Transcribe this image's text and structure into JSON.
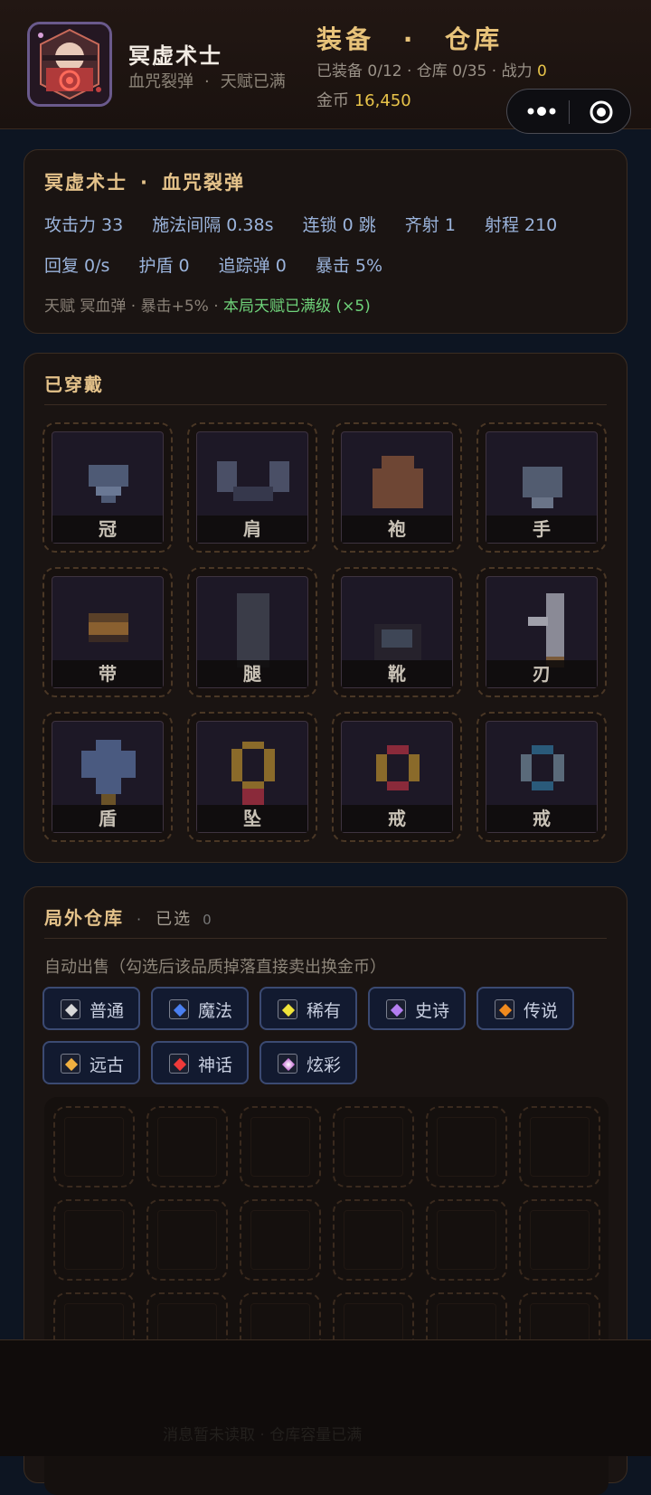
{
  "header": {
    "character_name": "冥虚术士",
    "skill": "血咒裂弹",
    "talent_status": "天赋已满",
    "title_left": "装备",
    "title_right": "仓库",
    "stats_prefix": "已装备 0/12 · 仓库 0/35 · 战力 ",
    "power": "0",
    "gold_label": "金币 ",
    "gold": "16,450",
    "more_icon": "more-icon",
    "close_icon": "target-icon"
  },
  "character": {
    "title_name": "冥虚术士",
    "title_skill": "血咒裂弹",
    "stats_row1": [
      "攻击力 33",
      "施法间隔 0.38s",
      "连锁 0 跳",
      "齐射 1",
      "射程 210"
    ],
    "stats_row2": [
      "回复 0/s",
      "护盾 0",
      "追踪弹 0",
      "暴击 5%"
    ],
    "talent_text": "天赋 冥血弹 · 暴击+5% · ",
    "talent_max": "本局天赋已满级 (×5)",
    "colors": {
      "stat": "#9bb4dc",
      "talent_max": "#6fd37a"
    }
  },
  "equipped": {
    "title": "已穿戴",
    "slots": [
      {
        "label": "冠",
        "icon": "crown-icon"
      },
      {
        "label": "肩",
        "icon": "shoulder-icon"
      },
      {
        "label": "袍",
        "icon": "robe-icon"
      },
      {
        "label": "手",
        "icon": "glove-icon"
      },
      {
        "label": "带",
        "icon": "belt-icon"
      },
      {
        "label": "腿",
        "icon": "leg-icon"
      },
      {
        "label": "靴",
        "icon": "boot-icon"
      },
      {
        "label": "刃",
        "icon": "blade-icon"
      },
      {
        "label": "盾",
        "icon": "shield-icon"
      },
      {
        "label": "坠",
        "icon": "pendant-icon"
      },
      {
        "label": "戒",
        "icon": "ring-red-icon"
      },
      {
        "label": "戒",
        "icon": "ring-blue-icon"
      }
    ]
  },
  "warehouse": {
    "title": "局外仓库",
    "selected_label": "已选",
    "selected_count": "0",
    "autosell_hint": "自动出售（勾选后该品质掉落直接卖出换金币）",
    "qualities": [
      {
        "label": "普通",
        "color": "#d8d8d8"
      },
      {
        "label": "魔法",
        "color": "#4a7ff0"
      },
      {
        "label": "稀有",
        "color": "#f0e43a"
      },
      {
        "label": "史诗",
        "color": "#b47ef0"
      },
      {
        "label": "传说",
        "color": "#f08a1e"
      },
      {
        "label": "远古",
        "color": "#f0b040"
      },
      {
        "label": "神话",
        "color": "#f03a3a"
      },
      {
        "label": "炫彩",
        "color": "#c060d0"
      }
    ]
  },
  "bottom": {
    "faint_text": "消息暂未读取 · 仓库容量已满"
  }
}
